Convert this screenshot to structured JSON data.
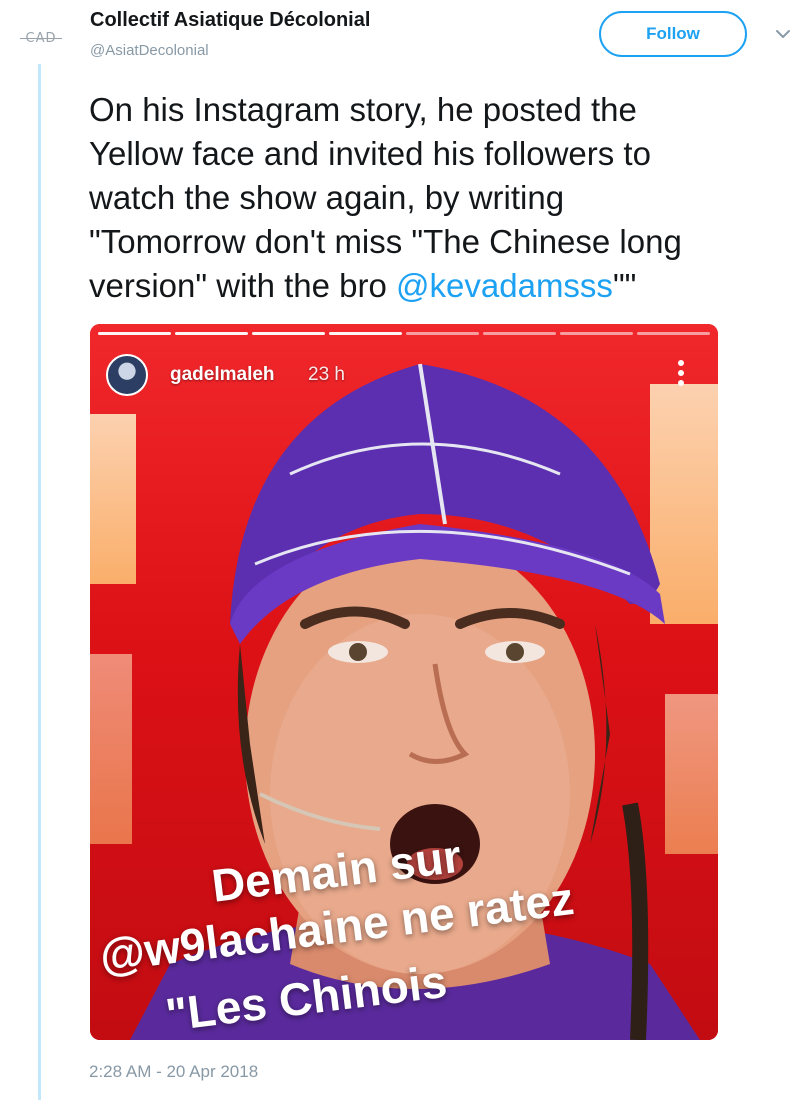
{
  "account": {
    "avatar_text": "CAD",
    "display_name": "Collectif Asiatique Décolonial",
    "handle": "@AsiatDecolonial",
    "follow_label": "Follow",
    "menu_icon": "chevron-down-icon"
  },
  "tweet": {
    "lines": [
      "On his Instagram story, he posted the",
      "Yellow face and invited his followers to",
      "watch the show again, by writing",
      "\"Tomorrow don't miss \"The Chinese long",
      "version\" with the bro "
    ],
    "mention": "@kevadamsss",
    "trailing": "\"\"",
    "timestamp": "2:28 AM - 20 Apr 2018"
  },
  "story": {
    "username": "gadelmaleh",
    "age": "23 h",
    "menu_icon": "more-vertical-icon",
    "caption_lines": [
      "Demain sur",
      "@w9lachaine ne ratez",
      "\"Les Chinois"
    ]
  },
  "colors": {
    "accent": "#1da1f2",
    "muted": "#8899a6",
    "thread": "#c4e8fb",
    "text": "#14171a"
  }
}
